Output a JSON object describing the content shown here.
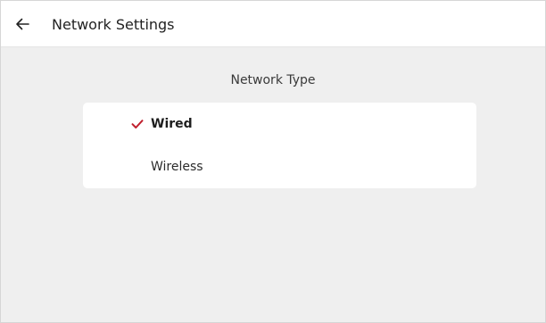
{
  "header": {
    "back_icon": "arrow-left-icon",
    "title": "Network Settings"
  },
  "section": {
    "title": "Network Type"
  },
  "options": [
    {
      "label": "Wired",
      "selected": true,
      "icon": "checkmark-icon"
    },
    {
      "label": "Wireless",
      "selected": false
    }
  ],
  "colors": {
    "accent": "#c0202e",
    "background": "#efefef",
    "card": "#ffffff"
  }
}
